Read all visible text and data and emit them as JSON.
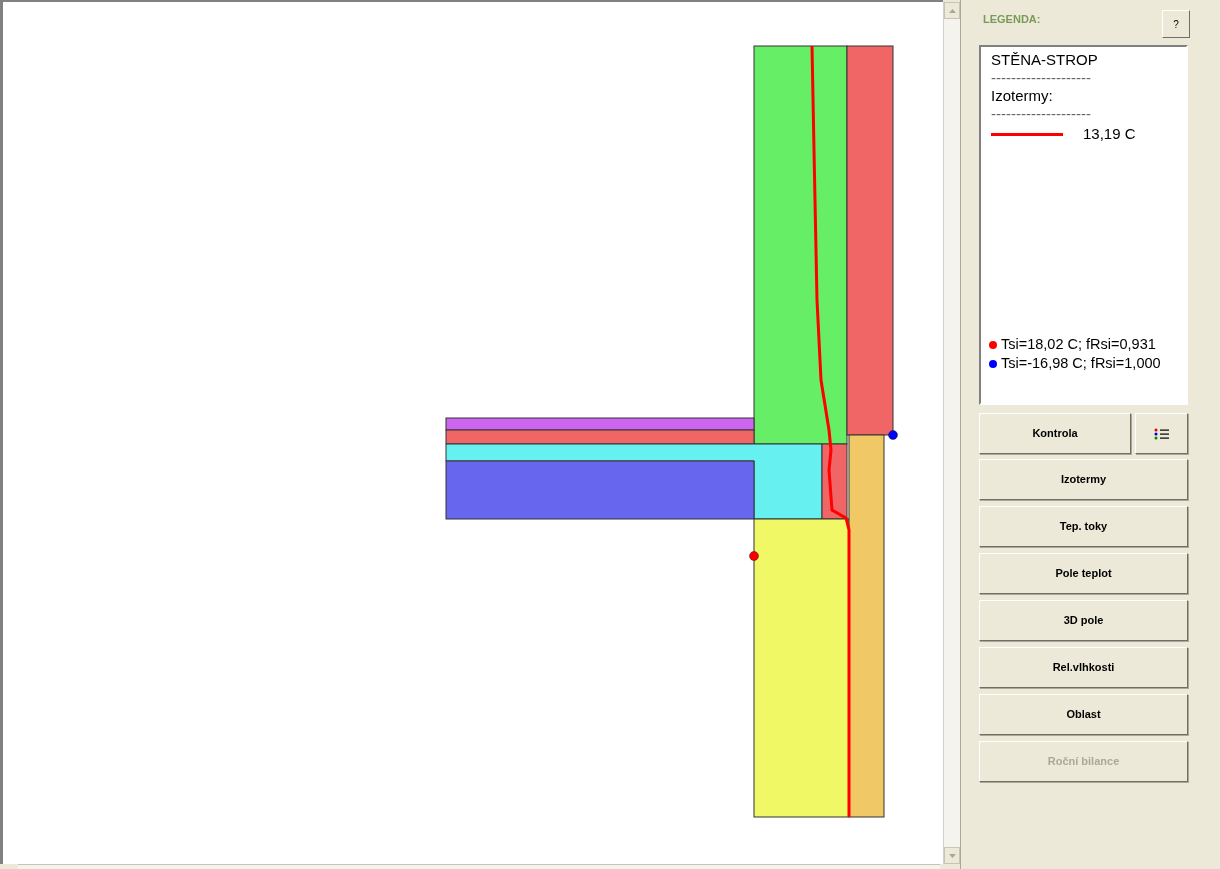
{
  "legend": {
    "heading": "LEGENDA:",
    "help_button": "?",
    "lines": [
      {
        "kind": "text",
        "text": "STĚNA-STROP"
      },
      {
        "kind": "text",
        "text": "--------------------"
      },
      {
        "kind": "text",
        "text": "Izotermy:"
      },
      {
        "kind": "text",
        "text": "--------------------"
      },
      {
        "kind": "isotherm",
        "text": "13,19 C",
        "color": "#ff0000"
      }
    ],
    "points": [
      {
        "text": "Tsi=18,02 C; fRsi=0,931",
        "color": "#ff0000"
      },
      {
        "text": "Tsi=-16,98 C; fRsi=1,000",
        "color": "#0000ff"
      }
    ]
  },
  "buttons": [
    {
      "label": "Kontrola",
      "disabled": false
    },
    {
      "label": "Izotermy",
      "disabled": false
    },
    {
      "label": "Tep. toky",
      "disabled": false
    },
    {
      "label": "Pole teplot",
      "disabled": false
    },
    {
      "label": "3D pole",
      "disabled": false
    },
    {
      "label": "Rel.vlhkosti",
      "disabled": false
    },
    {
      "label": "Oblast",
      "disabled": false
    },
    {
      "label": "Roční bilance",
      "disabled": true
    }
  ]
}
